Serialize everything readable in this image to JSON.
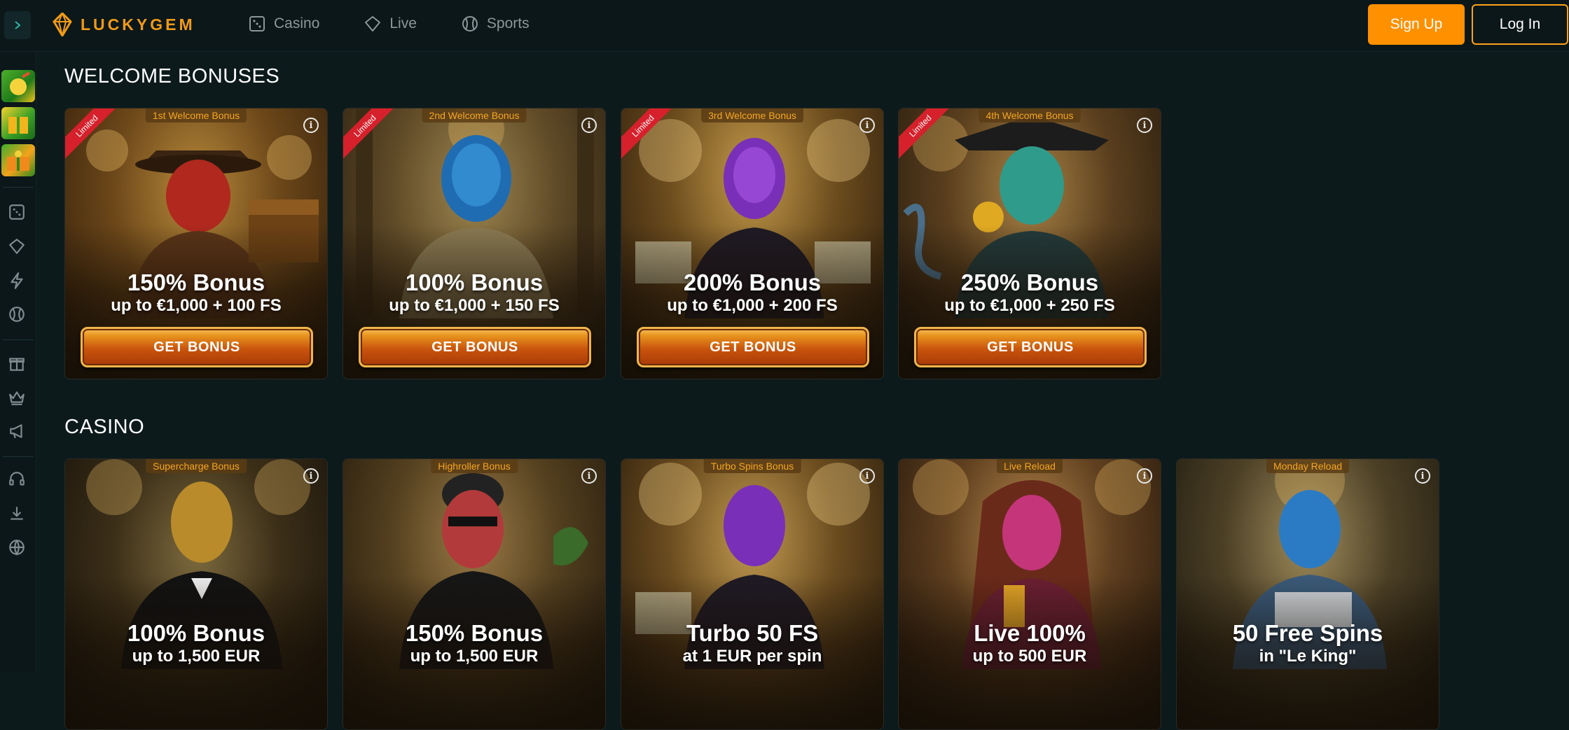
{
  "header": {
    "logo_text": "LUCKYGEM",
    "nav": [
      {
        "label": "Casino",
        "icon": "dice-icon"
      },
      {
        "label": "Live",
        "icon": "diamond-icon"
      },
      {
        "label": "Sports",
        "icon": "ball-icon"
      }
    ],
    "signup_label": "Sign Up",
    "login_label": "Log In"
  },
  "sidebar": {
    "promos": [
      "promo-tile",
      "promo-tile",
      "promo-tile"
    ],
    "icons": [
      "dice-icon",
      "diamond-icon",
      "lightning-icon",
      "ball-icon",
      "gift-icon",
      "crown-icon",
      "megaphone-icon",
      "headset-icon",
      "download-icon",
      "globe-icon"
    ]
  },
  "welcome": {
    "title": "WELCOME BONUSES",
    "cards": [
      {
        "tab": "1st Welcome Bonus",
        "ribbon": "Limited",
        "title": "150% Bonus",
        "sub": "up to €1,000 + 100 FS",
        "button": "GET BONUS"
      },
      {
        "tab": "2nd Welcome Bonus",
        "ribbon": "Limited",
        "title": "100% Bonus",
        "sub": "up to €1,000 + 150 FS",
        "button": "GET BONUS"
      },
      {
        "tab": "3rd Welcome Bonus",
        "ribbon": "Limited",
        "title": "200% Bonus",
        "sub": "up to €1,000 + 200 FS",
        "button": "GET BONUS"
      },
      {
        "tab": "4th Welcome Bonus",
        "ribbon": "Limited",
        "title": "250% Bonus",
        "sub": "up to €1,000 + 250 FS",
        "button": "GET BONUS"
      }
    ]
  },
  "casino": {
    "title": "CASINO",
    "cards": [
      {
        "tab": "Supercharge Bonus",
        "title": "100% Bonus",
        "sub": "up to 1,500 EUR"
      },
      {
        "tab": "Highroller Bonus",
        "title": "150% Bonus",
        "sub": "up to 1,500 EUR"
      },
      {
        "tab": "Turbo Spins Bonus",
        "title": "Turbo 50 FS",
        "sub": "at 1 EUR per spin"
      },
      {
        "tab": "Live Reload",
        "title": "Live 100%",
        "sub": "up to 500 EUR"
      },
      {
        "tab": "Monday Reload",
        "title": "50 Free Spins",
        "sub": "in \"Le King\""
      }
    ]
  },
  "colors": {
    "accent": "#ff9000",
    "background": "#0c1a1c",
    "limited_ribbon": "#d6202b"
  }
}
